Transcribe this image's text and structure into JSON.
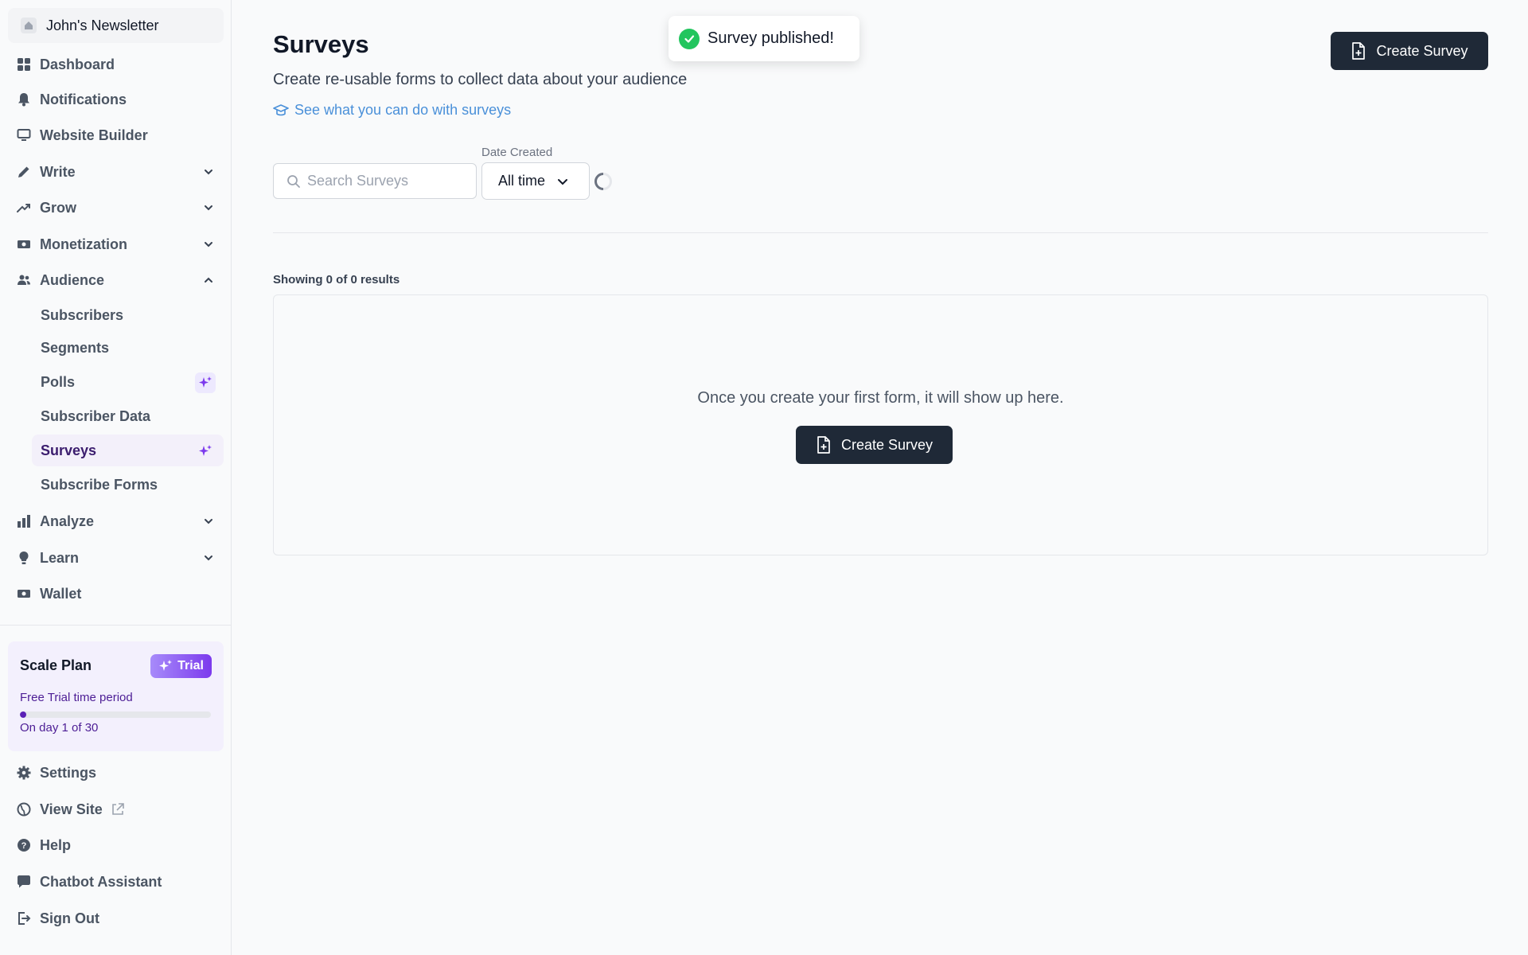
{
  "sidebar": {
    "publication": "John's Newsletter",
    "nav": {
      "dashboard": "Dashboard",
      "notifications": "Notifications",
      "website_builder": "Website Builder",
      "write": "Write",
      "grow": "Grow",
      "monetization": "Monetization",
      "audience": "Audience",
      "analyze": "Analyze",
      "learn": "Learn",
      "wallet": "Wallet"
    },
    "audience_items": {
      "subscribers": "Subscribers",
      "segments": "Segments",
      "polls": "Polls",
      "subscriber_data": "Subscriber Data",
      "surveys": "Surveys",
      "subscribe_forms": "Subscribe Forms"
    },
    "plan": {
      "title": "Scale Plan",
      "badge": "Trial",
      "subtitle": "Free Trial time period",
      "day_text": "On day 1 of 30",
      "progress_fraction": 0.033
    },
    "bottom": {
      "settings": "Settings",
      "view_site": "View Site",
      "help": "Help",
      "chatbot": "Chatbot Assistant",
      "sign_out": "Sign Out"
    }
  },
  "toast": {
    "message": "Survey published!"
  },
  "main": {
    "title": "Surveys",
    "subtitle": "Create re-usable forms to collect data about your audience",
    "help_link": "See what you can do with surveys",
    "create_button": "Create Survey",
    "search": {
      "placeholder": "Search Surveys",
      "value": ""
    },
    "date_filter": {
      "label": "Date Created",
      "value": "All time"
    },
    "results_text": "Showing 0 of 0 results",
    "empty": {
      "message": "Once you create your first form, it will show up here.",
      "button": "Create Survey"
    }
  },
  "colors": {
    "accent": "#1f2937",
    "active_bg": "#f3f0fa",
    "active_text": "#3b1d6e",
    "link": "#4a90d9",
    "success": "#22c55e",
    "trial_badge": "#7c3aed"
  }
}
